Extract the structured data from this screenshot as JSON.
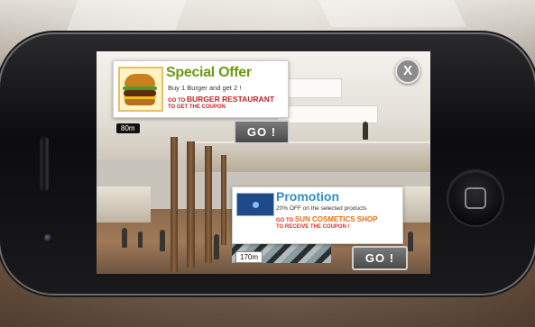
{
  "ar_app": {
    "close_label": "X",
    "offers": [
      {
        "title": "Special Offer",
        "description": "Buy 1 Burger and get 2 !",
        "cta_prefix": "GO TO",
        "store": "BURGER RESTAURANT",
        "cta_suffix": "TO GET THE COUPON",
        "distance": "80m",
        "button_label": "GO !",
        "title_color": "#6a9a14",
        "cta_color": "#c8202a"
      },
      {
        "title": "Promotion",
        "description": "20% OFF on the selected products",
        "cta_prefix": "GO TO",
        "store": "SUN COSMETICS SHOP",
        "cta_suffix": "TO RECEIVE THE COUPON !",
        "distance": "170m",
        "button_label": "GO !",
        "title_color": "#2e8ec8",
        "cta_color": "#e0302a"
      }
    ]
  }
}
